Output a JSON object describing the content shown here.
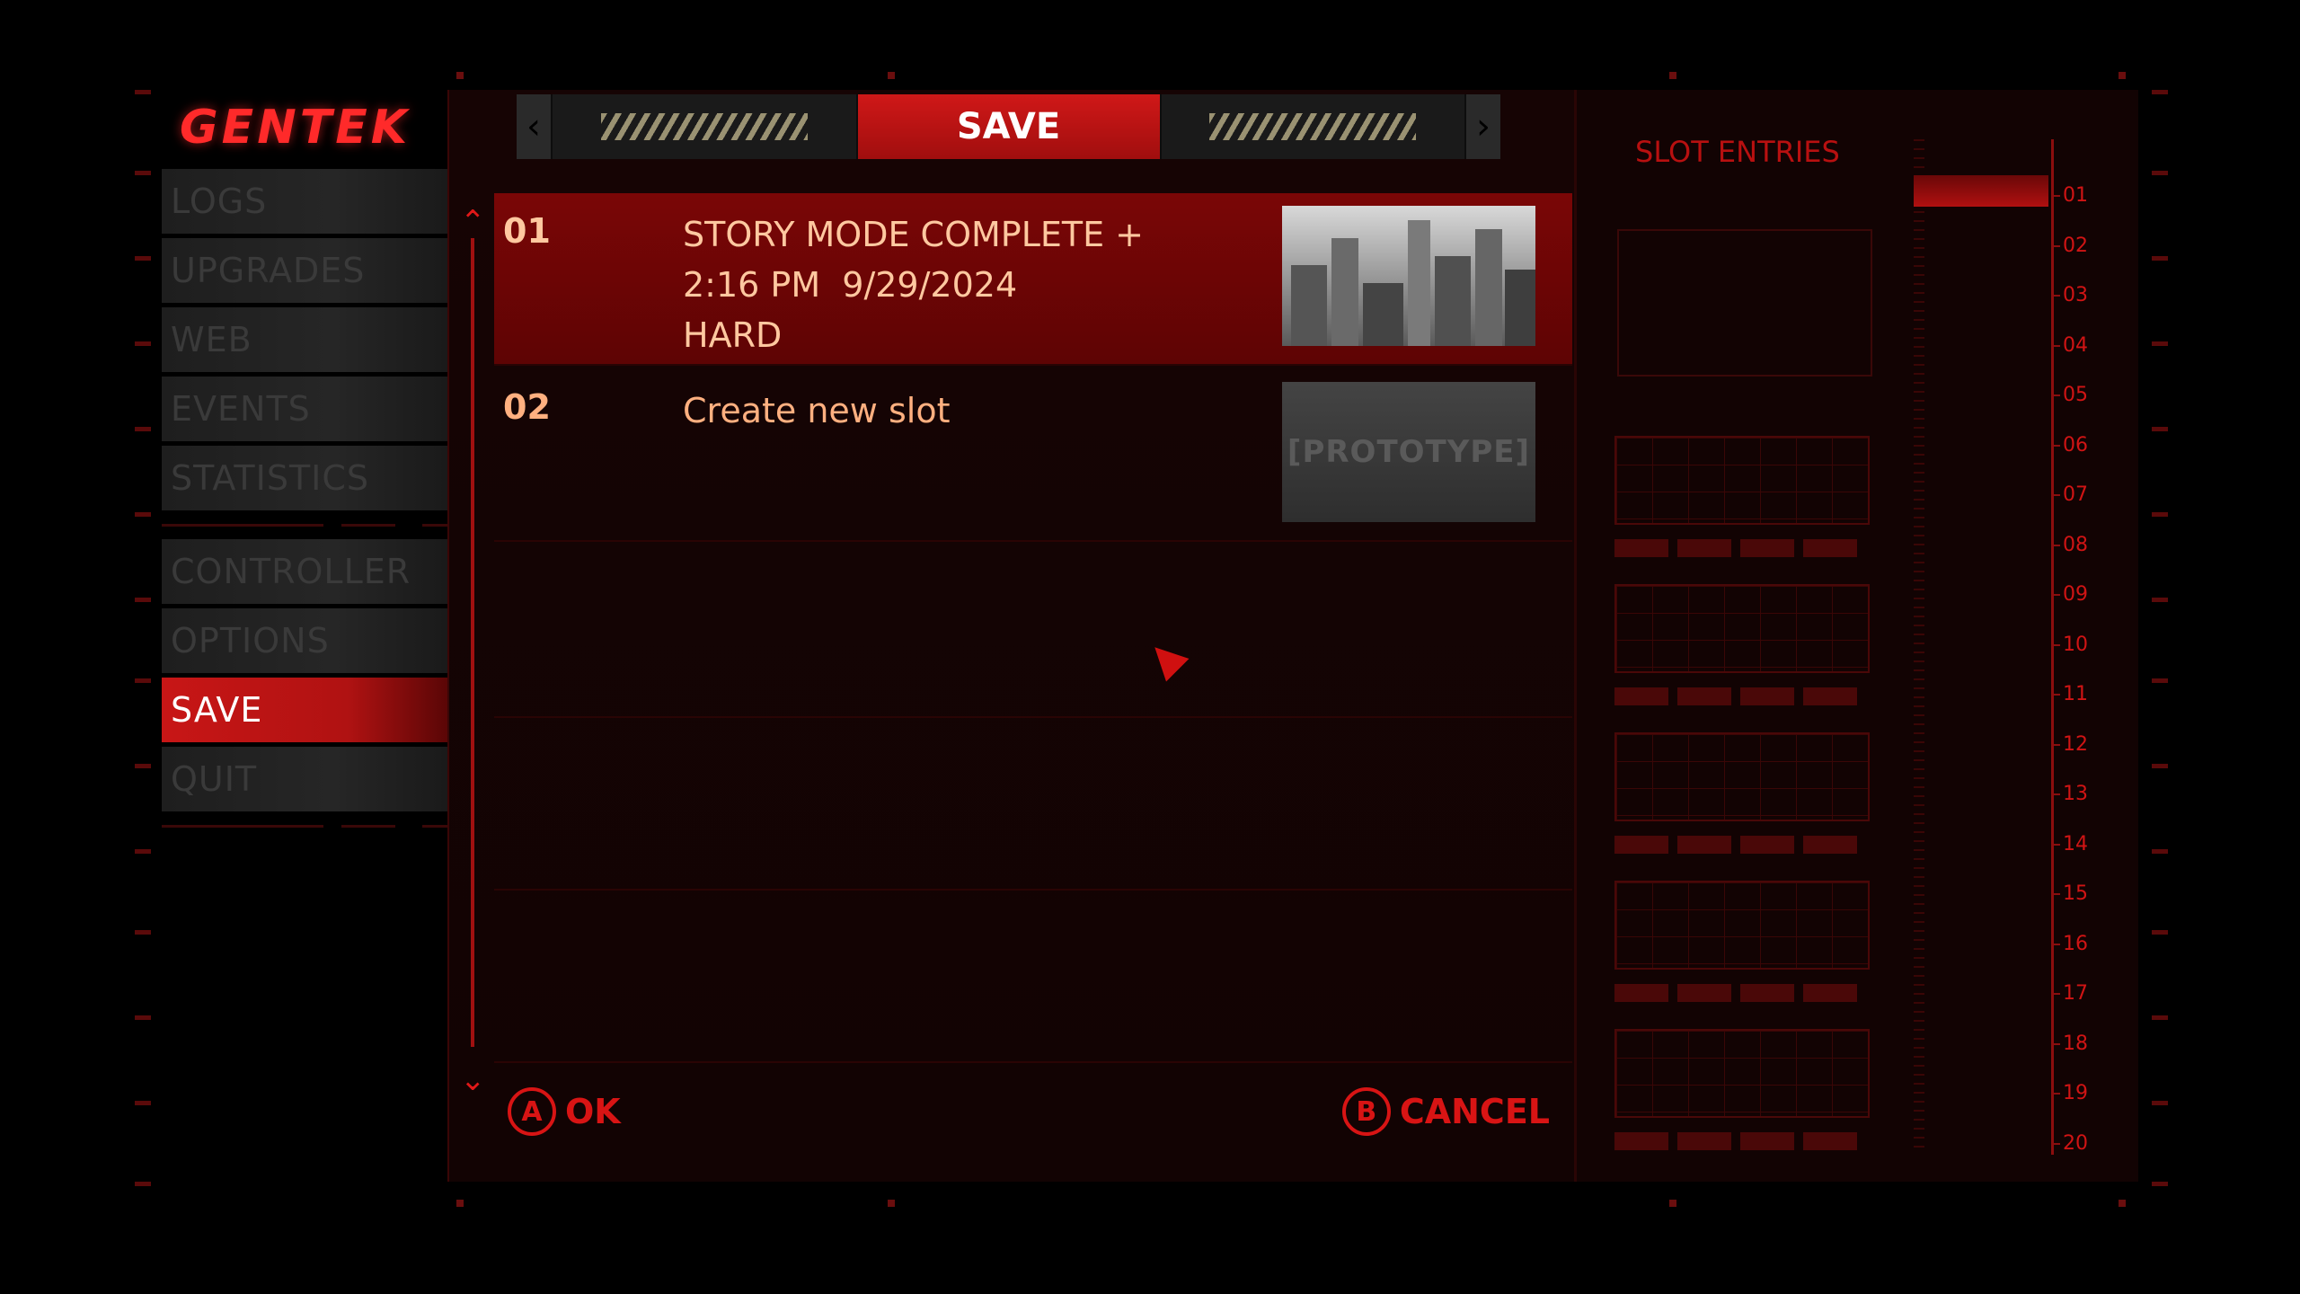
{
  "brand": "GENTEK",
  "menu": {
    "items": [
      "LOGS",
      "UPGRADES",
      "WEB",
      "EVENTS",
      "STATISTICS"
    ],
    "items2": [
      "CONTROLLER",
      "OPTIONS",
      "SAVE",
      "QUIT"
    ],
    "active": "SAVE"
  },
  "tabs": {
    "active_label": "SAVE",
    "left_arrow": "‹",
    "right_arrow": "›"
  },
  "slots": [
    {
      "num": "01",
      "line1": "STORY MODE COMPLETE +",
      "line2": "2:16 PM  9/29/2024",
      "line3": "HARD"
    },
    {
      "num": "02",
      "line1": "Create new slot",
      "thumb_label": "[PROTOTYPE]"
    }
  ],
  "footer": {
    "ok_key": "A",
    "ok_label": "OK",
    "cancel_key": "B",
    "cancel_label": "CANCEL"
  },
  "right_panel": {
    "title": "SLOT ENTRIES",
    "scale": [
      "01",
      "02",
      "03",
      "04",
      "05",
      "06",
      "07",
      "08",
      "09",
      "10",
      "11",
      "12",
      "13",
      "14",
      "15",
      "16",
      "17",
      "18",
      "19",
      "20"
    ]
  },
  "colors": {
    "accent": "#d01818",
    "text": "#ffb080",
    "background": "#120303"
  }
}
